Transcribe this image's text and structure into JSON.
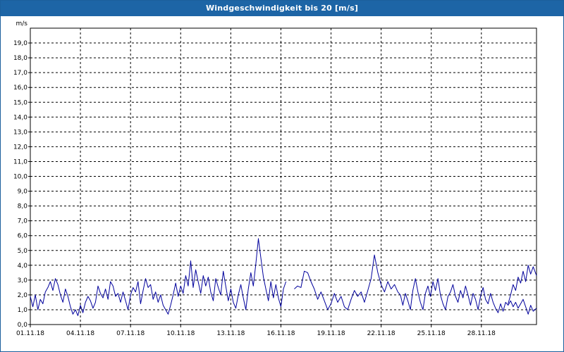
{
  "window": {
    "title": "Windgeschwindigkeit bis 20 [m/s]"
  },
  "chart_data": {
    "type": "line",
    "title": "Windgeschwindigkeit bis 20 [m/s]",
    "ylabel": "m/s",
    "xlabel": "",
    "ylim": [
      0,
      20
    ],
    "y_ticks": [
      "0,0",
      "1,0",
      "2,0",
      "3,0",
      "4,0",
      "5,0",
      "6,0",
      "7,0",
      "8,0",
      "9,0",
      "10,0",
      "11,0",
      "12,0",
      "13,0",
      "14,0",
      "15,0",
      "16,0",
      "17,0",
      "18,0",
      "19,0"
    ],
    "x_tick_labels": [
      "01.11.18",
      "04.11.18",
      "07.11.18",
      "10.11.18",
      "13.11.18",
      "16.11.18",
      "19.11.18",
      "22.11.18",
      "25.11.18",
      "28.11.18"
    ],
    "x_tick_days": [
      0,
      3,
      6,
      9,
      12,
      15,
      18,
      21,
      24,
      27
    ],
    "xlim_days": [
      0,
      30.3
    ],
    "grid": true,
    "line_color": "#00009c",
    "series": [
      {
        "name": "",
        "segments": [
          [
            [
              0.0,
              1.9
            ],
            [
              0.15,
              1.2
            ],
            [
              0.3,
              2.0
            ],
            [
              0.45,
              1.0
            ],
            [
              0.6,
              1.7
            ],
            [
              0.75,
              1.4
            ],
            [
              0.9,
              2.2
            ],
            [
              1.05,
              2.5
            ],
            [
              1.2,
              2.9
            ],
            [
              1.35,
              2.3
            ],
            [
              1.5,
              3.1
            ],
            [
              1.65,
              2.7
            ],
            [
              1.8,
              2.0
            ],
            [
              1.95,
              1.5
            ],
            [
              2.1,
              2.4
            ],
            [
              2.25,
              1.9
            ],
            [
              2.4,
              1.2
            ],
            [
              2.55,
              0.7
            ],
            [
              2.7,
              1.0
            ],
            [
              2.85,
              0.6
            ],
            [
              3.0,
              1.3
            ],
            [
              3.15,
              0.8
            ],
            [
              3.3,
              1.5
            ],
            [
              3.45,
              1.9
            ],
            [
              3.6,
              1.6
            ],
            [
              3.75,
              1.1
            ],
            [
              3.9,
              1.5
            ],
            [
              4.05,
              2.6
            ],
            [
              4.2,
              2.1
            ],
            [
              4.35,
              1.8
            ],
            [
              4.5,
              2.4
            ],
            [
              4.65,
              1.7
            ],
            [
              4.8,
              2.9
            ],
            [
              4.95,
              2.6
            ],
            [
              5.1,
              1.9
            ],
            [
              5.25,
              2.1
            ],
            [
              5.4,
              1.5
            ],
            [
              5.55,
              2.2
            ],
            [
              5.7,
              1.6
            ],
            [
              5.85,
              1.0
            ],
            [
              6.0,
              2.0
            ],
            [
              6.15,
              2.5
            ],
            [
              6.3,
              2.2
            ],
            [
              6.45,
              2.9
            ],
            [
              6.6,
              1.4
            ],
            [
              6.75,
              2.3
            ],
            [
              6.9,
              3.1
            ],
            [
              7.05,
              2.5
            ],
            [
              7.2,
              2.7
            ],
            [
              7.35,
              1.7
            ],
            [
              7.5,
              2.2
            ],
            [
              7.65,
              1.5
            ],
            [
              7.8,
              2.0
            ],
            [
              7.95,
              1.3
            ],
            [
              8.1,
              1.0
            ],
            [
              8.25,
              0.7
            ],
            [
              8.4,
              1.3
            ],
            [
              8.55,
              2.0
            ],
            [
              8.7,
              2.8
            ],
            [
              8.85,
              1.9
            ],
            [
              9.0,
              2.6
            ],
            [
              9.15,
              2.1
            ],
            [
              9.3,
              3.3
            ],
            [
              9.45,
              2.6
            ],
            [
              9.6,
              4.3
            ],
            [
              9.75,
              2.5
            ],
            [
              9.9,
              3.7
            ],
            [
              10.05,
              2.9
            ],
            [
              10.2,
              2.1
            ],
            [
              10.35,
              3.3
            ],
            [
              10.5,
              2.6
            ],
            [
              10.65,
              3.2
            ],
            [
              10.8,
              2.2
            ],
            [
              10.95,
              1.6
            ],
            [
              11.1,
              3.1
            ],
            [
              11.25,
              2.5
            ],
            [
              11.4,
              2.0
            ],
            [
              11.55,
              3.6
            ],
            [
              11.7,
              2.6
            ],
            [
              11.85,
              1.6
            ],
            [
              12.0,
              2.4
            ],
            [
              12.15,
              1.5
            ],
            [
              12.3,
              1.1
            ],
            [
              12.45,
              2.0
            ],
            [
              12.6,
              2.7
            ],
            [
              12.75,
              1.8
            ],
            [
              12.9,
              1.0
            ],
            [
              13.05,
              2.4
            ],
            [
              13.2,
              3.5
            ],
            [
              13.35,
              2.6
            ],
            [
              13.5,
              4.1
            ],
            [
              13.65,
              5.8
            ],
            [
              13.8,
              4.5
            ],
            [
              13.95,
              3.2
            ],
            [
              14.1,
              2.4
            ],
            [
              14.25,
              1.6
            ],
            [
              14.4,
              2.9
            ],
            [
              14.55,
              1.8
            ],
            [
              14.7,
              2.7
            ],
            [
              14.85,
              1.8
            ],
            [
              15.0,
              1.2
            ],
            [
              15.15,
              2.4
            ],
            [
              15.3,
              2.9
            ]
          ],
          [
            [
              15.8,
              2.4
            ],
            [
              16.0,
              2.6
            ],
            [
              16.2,
              2.5
            ],
            [
              16.4,
              3.6
            ],
            [
              16.6,
              3.5
            ],
            [
              16.8,
              2.9
            ],
            [
              17.0,
              2.4
            ],
            [
              17.2,
              1.7
            ],
            [
              17.4,
              2.2
            ],
            [
              17.6,
              1.6
            ],
            [
              17.8,
              1.0
            ],
            [
              18.0,
              1.4
            ],
            [
              18.2,
              2.1
            ],
            [
              18.4,
              1.5
            ],
            [
              18.6,
              1.9
            ],
            [
              18.8,
              1.2
            ],
            [
              19.0,
              1.0
            ],
            [
              19.2,
              1.7
            ],
            [
              19.4,
              2.3
            ],
            [
              19.6,
              1.9
            ],
            [
              19.8,
              2.2
            ],
            [
              20.0,
              1.5
            ],
            [
              20.2,
              2.3
            ],
            [
              20.4,
              3.1
            ],
            [
              20.6,
              4.7
            ],
            [
              20.8,
              3.5
            ],
            [
              21.0,
              2.7
            ],
            [
              21.2,
              2.2
            ],
            [
              21.4,
              2.9
            ],
            [
              21.6,
              2.4
            ],
            [
              21.8,
              2.7
            ],
            [
              22.0,
              2.2
            ]
          ],
          [
            [
              22.0,
              2.2
            ],
            [
              22.15,
              2.0
            ],
            [
              22.3,
              1.3
            ],
            [
              22.45,
              2.1
            ],
            [
              22.6,
              1.6
            ],
            [
              22.75,
              1.0
            ],
            [
              22.9,
              2.3
            ],
            [
              23.05,
              3.1
            ],
            [
              23.2,
              2.2
            ],
            [
              23.35,
              1.5
            ],
            [
              23.5,
              1.0
            ],
            [
              23.65,
              2.1
            ],
            [
              23.8,
              2.6
            ],
            [
              23.95,
              1.9
            ],
            [
              24.1,
              2.9
            ],
            [
              24.25,
              2.3
            ],
            [
              24.4,
              3.1
            ],
            [
              24.55,
              2.0
            ],
            [
              24.7,
              1.4
            ],
            [
              24.85,
              1.0
            ],
            [
              25.0,
              1.9
            ],
            [
              25.15,
              2.2
            ],
            [
              25.3,
              2.7
            ],
            [
              25.45,
              1.9
            ],
            [
              25.6,
              1.5
            ],
            [
              25.75,
              2.3
            ],
            [
              25.9,
              1.8
            ],
            [
              26.05,
              2.6
            ],
            [
              26.2,
              2.0
            ],
            [
              26.35,
              1.3
            ],
            [
              26.5,
              2.1
            ],
            [
              26.65,
              1.7
            ],
            [
              26.8,
              1.0
            ],
            [
              26.95,
              1.9
            ],
            [
              27.1,
              2.5
            ],
            [
              27.25,
              1.7
            ],
            [
              27.4,
              1.4
            ],
            [
              27.55,
              2.1
            ],
            [
              27.7,
              1.5
            ],
            [
              27.85,
              1.1
            ],
            [
              28.0,
              0.8
            ],
            [
              28.15,
              1.4
            ],
            [
              28.3,
              0.9
            ],
            [
              28.45,
              1.5
            ],
            [
              28.6,
              1.3
            ],
            [
              28.75,
              1.6
            ],
            [
              28.9,
              1.2
            ],
            [
              29.05,
              1.5
            ],
            [
              29.2,
              1.1
            ],
            [
              29.35,
              1.4
            ],
            [
              29.5,
              1.7
            ],
            [
              29.65,
              1.2
            ],
            [
              29.8,
              0.7
            ],
            [
              29.95,
              1.3
            ],
            [
              30.1,
              0.9
            ],
            [
              30.3,
              1.1
            ]
          ],
          [
            [
              28.6,
              1.4
            ],
            [
              28.75,
              2.0
            ],
            [
              28.9,
              2.7
            ],
            [
              29.05,
              2.3
            ],
            [
              29.2,
              3.2
            ],
            [
              29.35,
              2.8
            ],
            [
              29.5,
              3.6
            ],
            [
              29.65,
              2.9
            ],
            [
              29.8,
              4.0
            ],
            [
              29.95,
              3.4
            ],
            [
              30.1,
              3.9
            ],
            [
              30.3,
              3.3
            ]
          ]
        ]
      }
    ]
  }
}
